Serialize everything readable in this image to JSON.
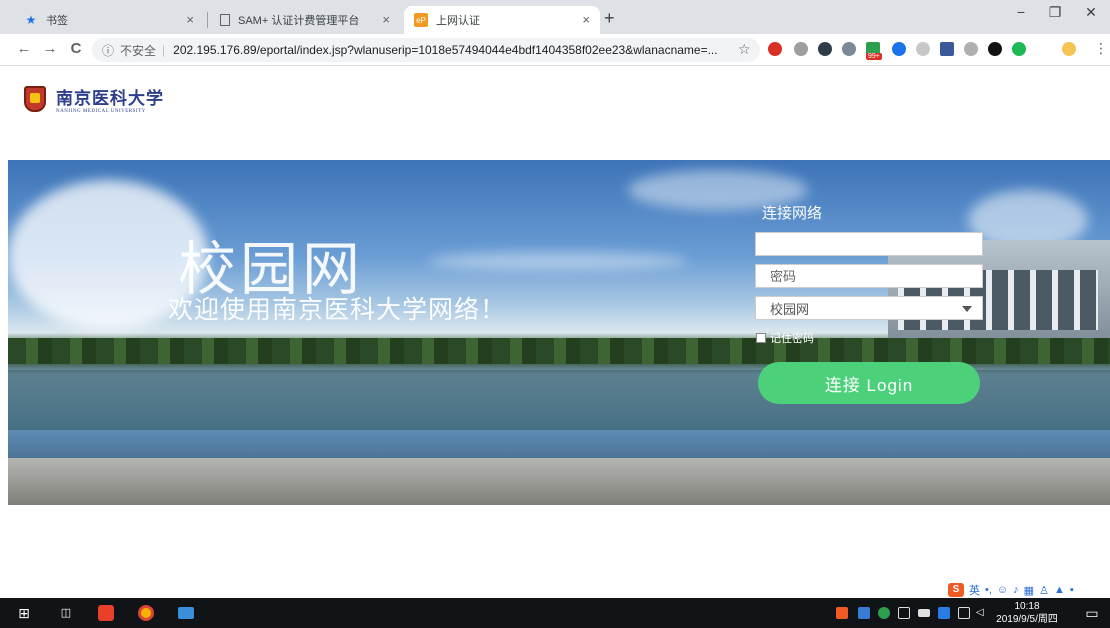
{
  "browser": {
    "tabs": [
      {
        "label": "书签",
        "icon": "star-icon"
      },
      {
        "label": "SAM+ 认证计费管理平台",
        "icon": "page-icon"
      },
      {
        "label": "上网认证",
        "icon": "ep-favicon-icon"
      }
    ],
    "new_tab": "+",
    "window_controls": [
      "−",
      "❐",
      "✕"
    ],
    "nav": {
      "back": "←",
      "forward": "→",
      "reload": "C"
    },
    "security_label": "不安全",
    "url": "202.195.176.89/eportal/index.jsp?wlanuserip=1018e57494044e4bdf1404358f02ee23&wlanacname=...",
    "bookmark_star": "☆",
    "extension_badge": "99+",
    "menu": "⋮"
  },
  "page": {
    "logo": {
      "name_zh": "南京医科大学",
      "name_en": "NANJING MEDICAL UNIVERSITY"
    },
    "hero": {
      "title": "校园网",
      "subtitle": "欢迎使用南京医科大学网络！"
    },
    "form": {
      "title": "连接网络",
      "username_placeholder": "",
      "password_placeholder": "密码",
      "service_selected": "校园网",
      "remember_label": "记住密码",
      "login_button": "连接 Login"
    }
  },
  "ime": {
    "mode_label": "英"
  },
  "taskbar": {
    "time": "10:18",
    "date": "2019/9/5/周四"
  },
  "colors": {
    "login_button": "#4cd17a",
    "taskbar": "#101417",
    "tabstrip": "#dee1e6"
  }
}
